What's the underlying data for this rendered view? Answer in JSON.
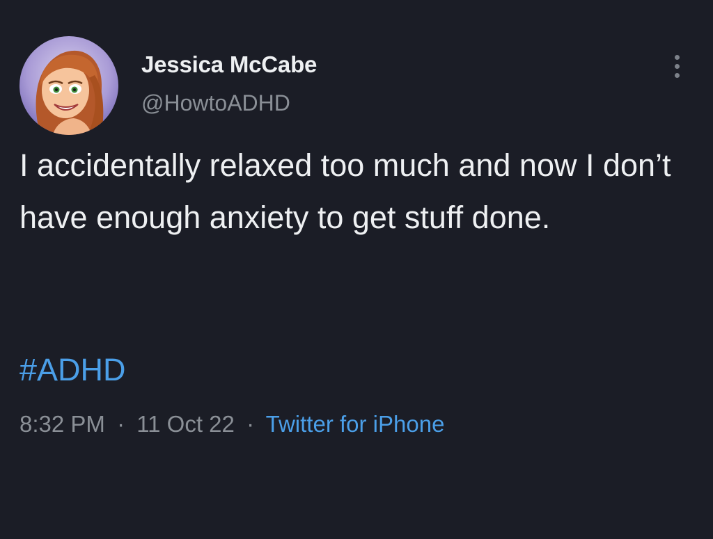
{
  "author": {
    "display_name": "Jessica McCabe",
    "handle": "@HowtoADHD",
    "avatar_icon": "avatar-cartoon-portrait"
  },
  "tweet": {
    "text": "I accidentally relaxed too much and now I don’t have enough anxiety to get stuff done.",
    "hashtag": "#ADHD",
    "time": "8:32 PM",
    "date": "11 Oct 22",
    "separator": "·",
    "source": "Twitter for iPhone"
  },
  "menu": {
    "icon": "more-vertical-icon"
  },
  "colors": {
    "background": "#1b1d26",
    "text": "#eef0f2",
    "secondary": "#8a8f96",
    "link": "#4b9fe8"
  }
}
